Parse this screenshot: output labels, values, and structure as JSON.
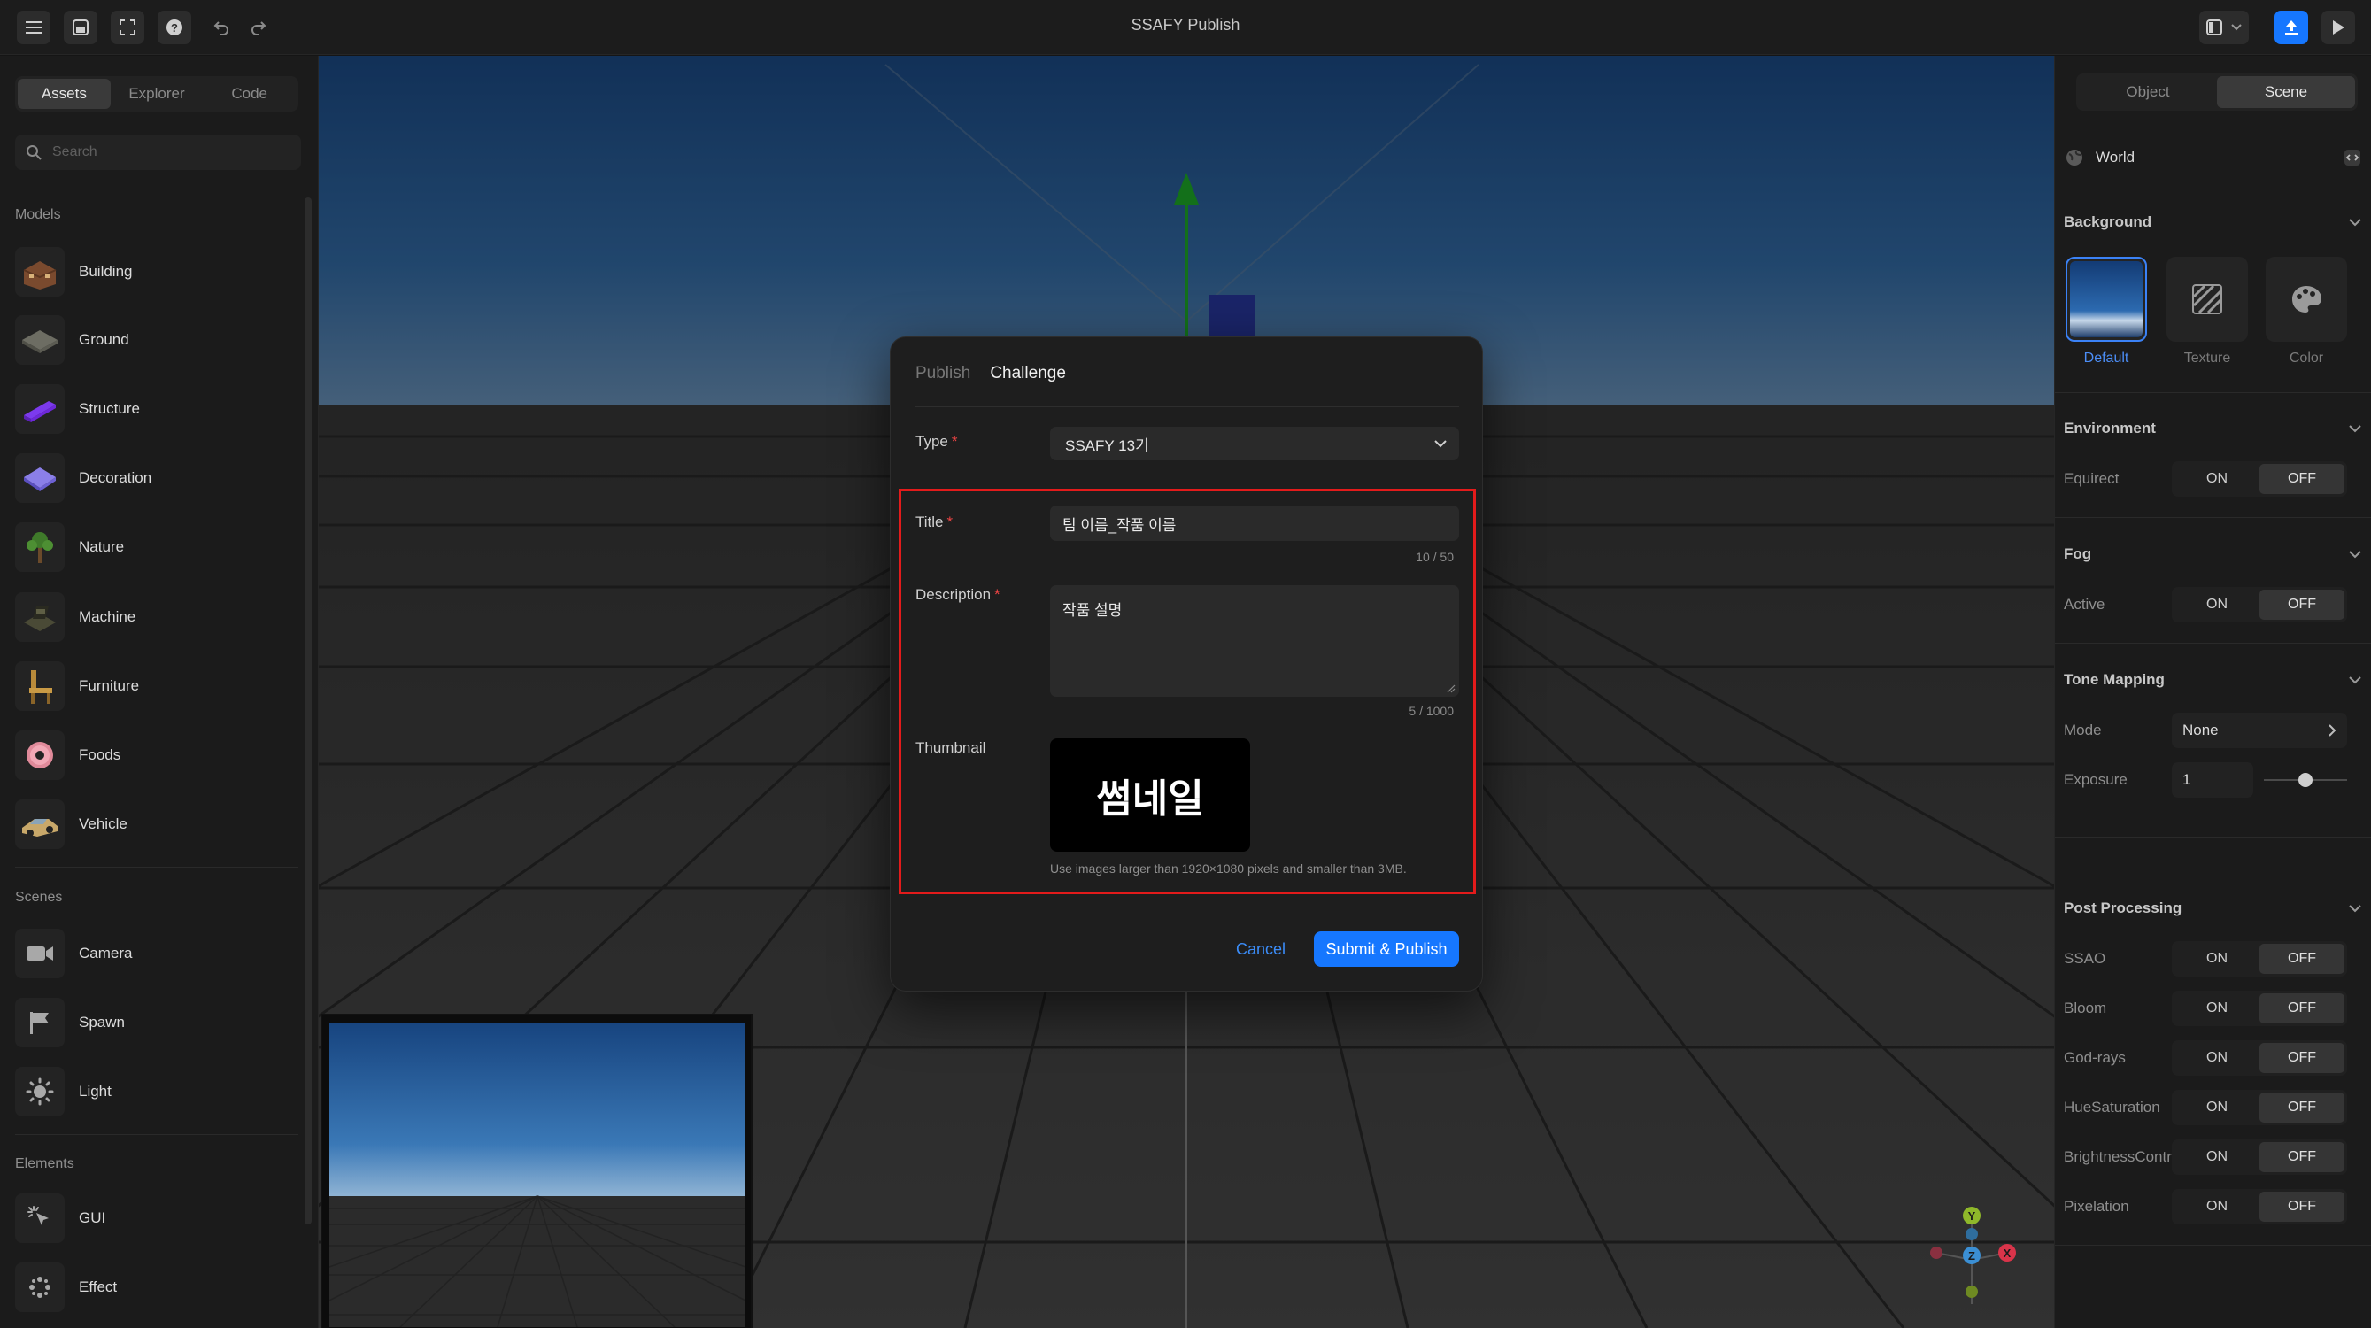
{
  "app": {
    "title": "SSAFY Publish"
  },
  "toolbar": {
    "icons": [
      "menu-icon",
      "save-icon",
      "fullscreen-icon",
      "help-icon",
      "undo-icon",
      "redo-icon",
      "layout-icon",
      "chevron-down-icon",
      "publish-icon",
      "play-icon"
    ]
  },
  "left_panel": {
    "tabs": [
      {
        "label": "Assets",
        "active": true
      },
      {
        "label": "Explorer",
        "active": false
      },
      {
        "label": "Code",
        "active": false
      }
    ],
    "search_placeholder": "Search",
    "sections": [
      {
        "title": "Models",
        "items": [
          {
            "label": "Building",
            "icon": "building-icon"
          },
          {
            "label": "Ground",
            "icon": "ground-icon"
          },
          {
            "label": "Structure",
            "icon": "structure-icon"
          },
          {
            "label": "Decoration",
            "icon": "decoration-icon"
          },
          {
            "label": "Nature",
            "icon": "tree-icon"
          },
          {
            "label": "Machine",
            "icon": "machine-icon"
          },
          {
            "label": "Furniture",
            "icon": "chair-icon"
          },
          {
            "label": "Foods",
            "icon": "donut-icon"
          },
          {
            "label": "Vehicle",
            "icon": "car-icon"
          }
        ]
      },
      {
        "title": "Scenes",
        "items": [
          {
            "label": "Camera",
            "icon": "camera-icon"
          },
          {
            "label": "Spawn",
            "icon": "flag-icon"
          },
          {
            "label": "Light",
            "icon": "sun-icon"
          }
        ]
      },
      {
        "title": "Elements",
        "items": [
          {
            "label": "GUI",
            "icon": "cursor-click-icon"
          },
          {
            "label": "Effect",
            "icon": "sparkle-icon"
          }
        ]
      }
    ]
  },
  "right_panel": {
    "tabs": [
      {
        "label": "Object",
        "active": false
      },
      {
        "label": "Scene",
        "active": true
      }
    ],
    "world_label": "World",
    "background": {
      "title": "Background",
      "options": [
        {
          "label": "Default",
          "active": true
        },
        {
          "label": "Texture",
          "active": false
        },
        {
          "label": "Color",
          "active": false
        }
      ]
    },
    "environment": {
      "title": "Environment",
      "rows": [
        {
          "label": "Equirect",
          "value": "OFF"
        }
      ]
    },
    "fog": {
      "title": "Fog",
      "rows": [
        {
          "label": "Active",
          "value": "OFF"
        }
      ]
    },
    "tone_mapping": {
      "title": "Tone Mapping",
      "mode_label": "Mode",
      "mode_value": "None",
      "exposure_label": "Exposure",
      "exposure_value": "1",
      "exposure_slider_fraction": 0.5
    },
    "post_processing": {
      "title": "Post Processing",
      "rows": [
        {
          "label": "SSAO",
          "value": "OFF"
        },
        {
          "label": "Bloom",
          "value": "OFF"
        },
        {
          "label": "God-rays",
          "value": "OFF"
        },
        {
          "label": "HueSaturation",
          "value": "OFF"
        },
        {
          "label": "BrightnessContrast",
          "value": "OFF"
        },
        {
          "label": "Pixelation",
          "value": "OFF"
        }
      ]
    },
    "toggle_on": "ON",
    "toggle_off": "OFF"
  },
  "viewport": {
    "gizmo_axes": [
      "Y",
      "Z",
      "X"
    ]
  },
  "modal": {
    "tabs": [
      {
        "label": "Publish",
        "active": false
      },
      {
        "label": "Challenge",
        "active": true
      }
    ],
    "type_label": "Type",
    "type_value": "SSAFY 13기",
    "title_label": "Title",
    "title_value": "팀 이름_작품 이름",
    "title_counter": "10 / 50",
    "description_label": "Description",
    "description_value": "작품 설명",
    "description_counter": "5 / 1000",
    "thumbnail_label": "Thumbnail",
    "thumbnail_text": "썸네일",
    "thumbnail_hint": "Use images larger than 1920×1080 pixels and smaller than 3MB.",
    "cancel_label": "Cancel",
    "submit_label": "Submit & Publish",
    "required_mark": "*"
  }
}
